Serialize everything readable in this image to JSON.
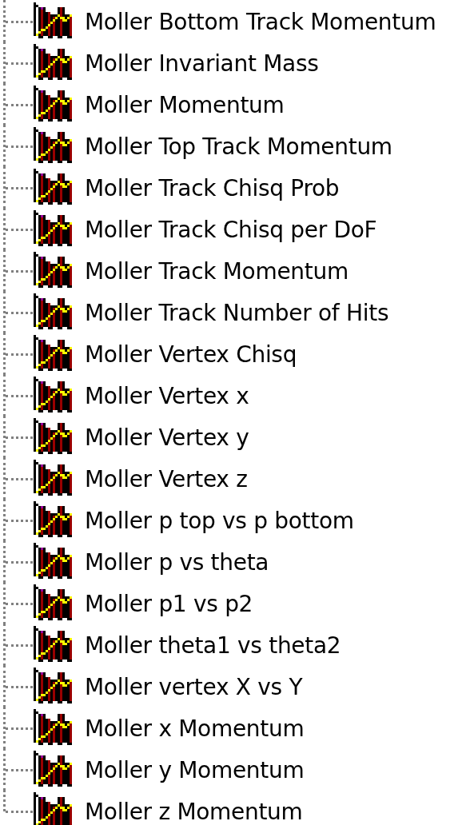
{
  "tree": {
    "items": [
      {
        "label": "Moller Bottom Track Momentum"
      },
      {
        "label": "Moller Invariant Mass"
      },
      {
        "label": "Moller Momentum"
      },
      {
        "label": "Moller Top Track Momentum"
      },
      {
        "label": "Moller Track Chisq Prob"
      },
      {
        "label": "Moller Track Chisq per DoF"
      },
      {
        "label": "Moller Track Momentum"
      },
      {
        "label": "Moller Track Number of Hits"
      },
      {
        "label": "Moller Vertex Chisq"
      },
      {
        "label": "Moller Vertex x"
      },
      {
        "label": "Moller Vertex y"
      },
      {
        "label": "Moller Vertex z"
      },
      {
        "label": "Moller p top vs p bottom"
      },
      {
        "label": "Moller p vs theta"
      },
      {
        "label": "Moller p1 vs p2"
      },
      {
        "label": "Moller theta1 vs theta2"
      },
      {
        "label": "Moller vertex X vs Y"
      },
      {
        "label": "Moller x Momentum"
      },
      {
        "label": "Moller y Momentum"
      },
      {
        "label": "Moller z Momentum"
      }
    ]
  }
}
